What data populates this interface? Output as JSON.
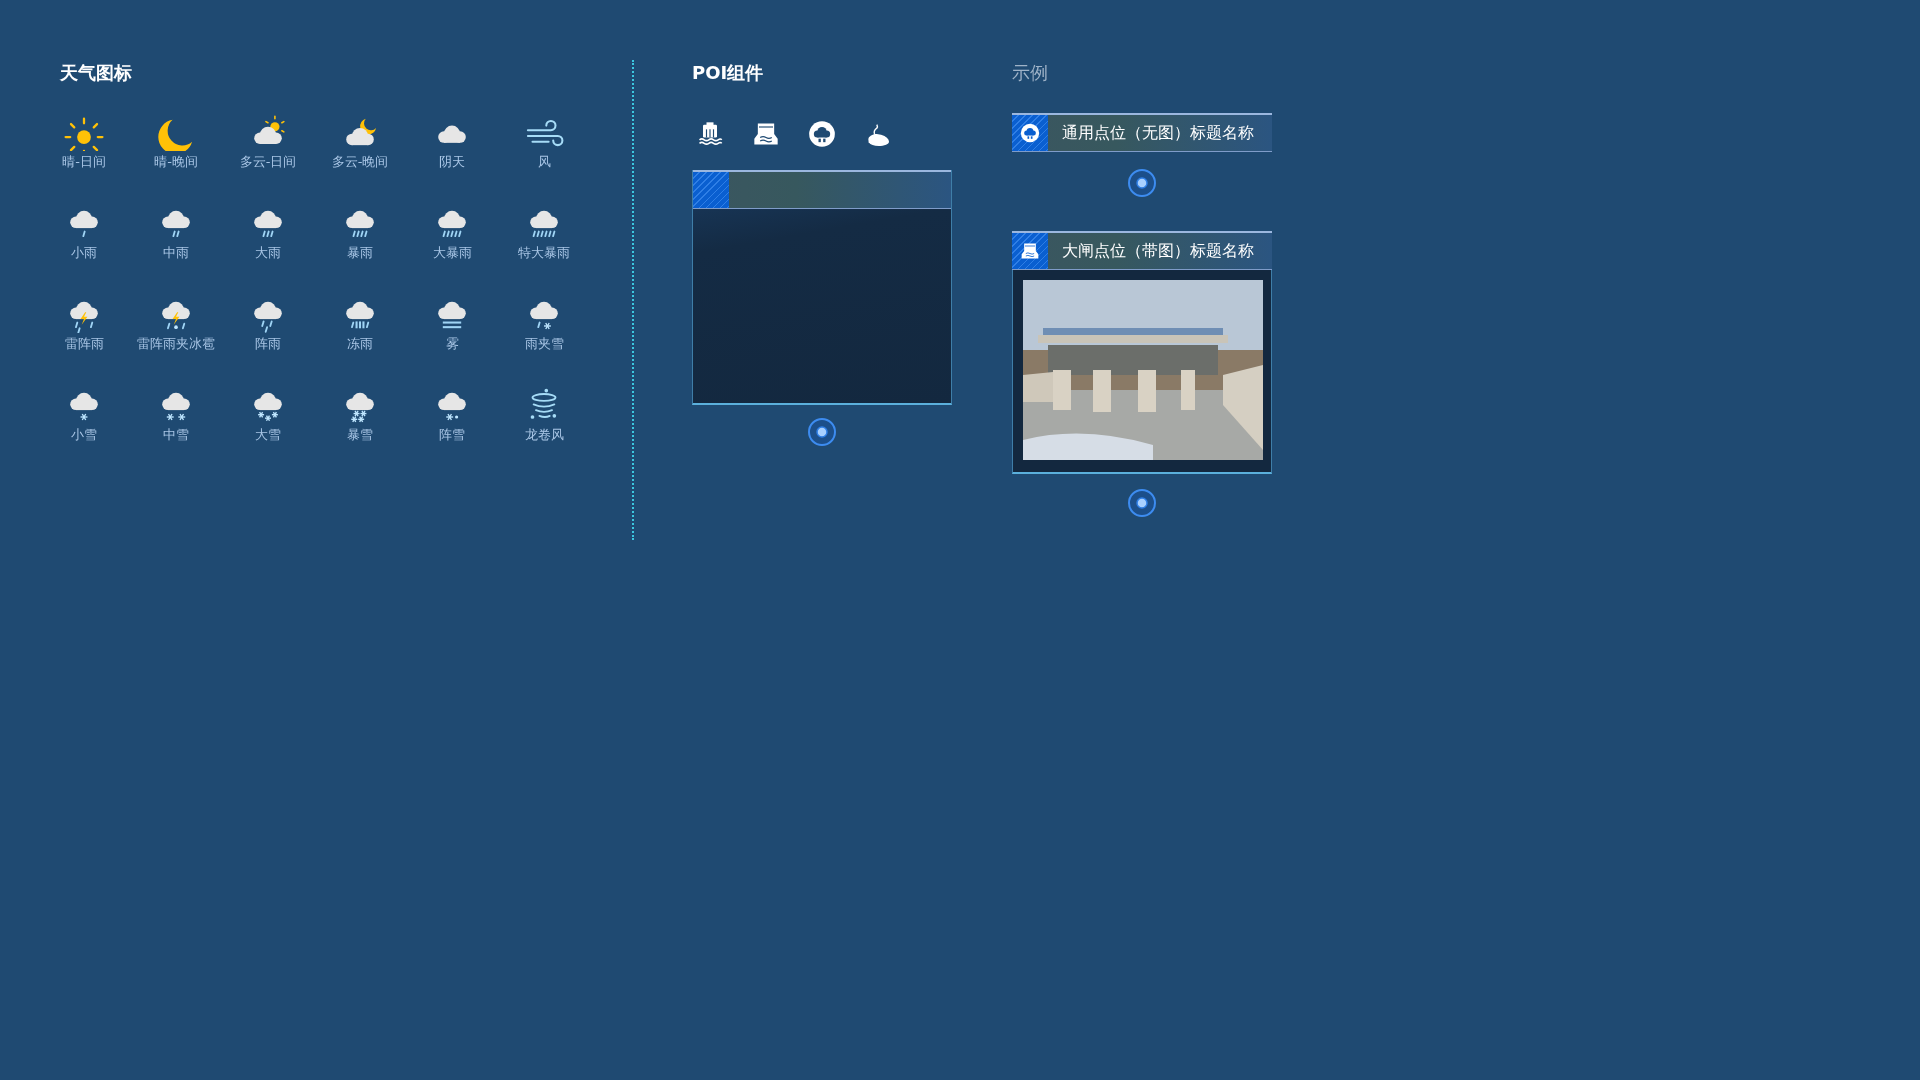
{
  "weather": {
    "title": "天气图标",
    "items": [
      {
        "label": "晴-日间",
        "kind": "sunny"
      },
      {
        "label": "晴-晚间",
        "kind": "night"
      },
      {
        "label": "多云-日间",
        "kind": "partlyday"
      },
      {
        "label": "多云-晚间",
        "kind": "partlynight"
      },
      {
        "label": "阴天",
        "kind": "overcast"
      },
      {
        "label": "风",
        "kind": "wind"
      },
      {
        "label": "小雨",
        "kind": "rain1"
      },
      {
        "label": "中雨",
        "kind": "rain2"
      },
      {
        "label": "大雨",
        "kind": "rain3"
      },
      {
        "label": "暴雨",
        "kind": "rain4"
      },
      {
        "label": "大暴雨",
        "kind": "rain5"
      },
      {
        "label": "特大暴雨",
        "kind": "rain6"
      },
      {
        "label": "雷阵雨",
        "kind": "thunder"
      },
      {
        "label": "雷阵雨夹冰雹",
        "kind": "hail"
      },
      {
        "label": "阵雨",
        "kind": "shower"
      },
      {
        "label": "冻雨",
        "kind": "freezing"
      },
      {
        "label": "雾",
        "kind": "fog"
      },
      {
        "label": "雨夹雪",
        "kind": "sleet"
      },
      {
        "label": "小雪",
        "kind": "snow1"
      },
      {
        "label": "中雪",
        "kind": "snow2"
      },
      {
        "label": "大雪",
        "kind": "snow3"
      },
      {
        "label": "暴雪",
        "kind": "snow4"
      },
      {
        "label": "阵雪",
        "kind": "snowshower"
      },
      {
        "label": "龙卷风",
        "kind": "tornado"
      }
    ]
  },
  "poi": {
    "title": "POI组件",
    "icons": [
      {
        "kind": "station"
      },
      {
        "kind": "gate"
      },
      {
        "kind": "gauge"
      },
      {
        "kind": "reservoir"
      }
    ]
  },
  "examples": {
    "title": "示例",
    "cards": [
      {
        "kind": "plain",
        "title": "通用点位（无图）标题名称"
      },
      {
        "title": "大闸点位（带图）标题名称"
      }
    ]
  }
}
